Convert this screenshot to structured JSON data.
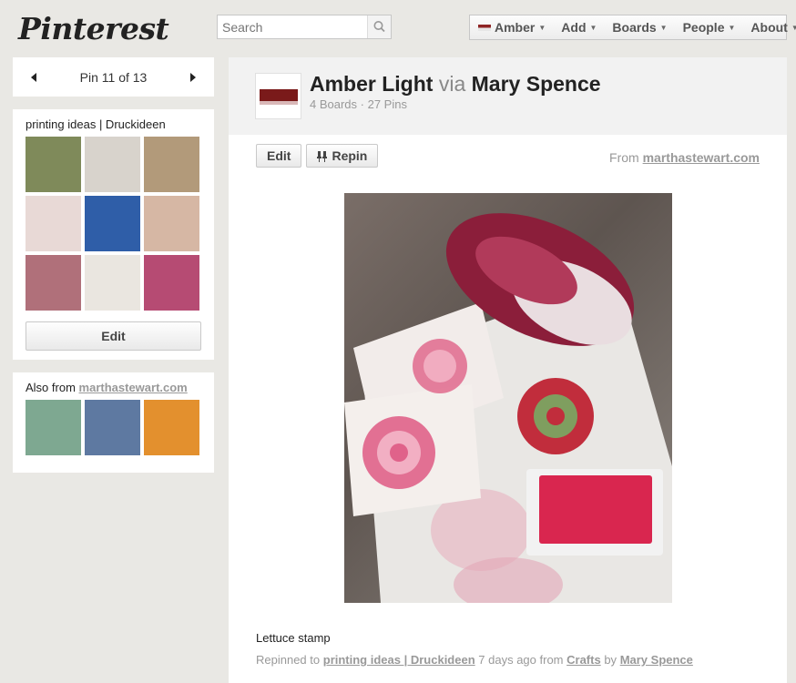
{
  "header": {
    "logo": "Pinterest",
    "search": {
      "placeholder": "Search",
      "value": ""
    },
    "nav": [
      {
        "label": "Amber",
        "flag": true
      },
      {
        "label": "Add"
      },
      {
        "label": "Boards"
      },
      {
        "label": "People"
      },
      {
        "label": "About"
      }
    ]
  },
  "sidebar": {
    "pager": {
      "text": "Pin 11 of 13"
    },
    "board": {
      "title": "printing ideas | Druckideen",
      "edit_label": "Edit",
      "thumbs": [
        "#7f8a5a",
        "#d8d3cc",
        "#b29a7a",
        "#e8d9d6",
        "#2f5ea8",
        "#d6b7a4",
        "#b0707a",
        "#eae6e0",
        "#b64b73"
      ]
    },
    "also": {
      "label": "Also from",
      "link": "marthastewart.com",
      "thumbs": [
        "#7ea891",
        "#5e79a1",
        "#e3902e"
      ]
    }
  },
  "pin": {
    "user_name": "Amber Light",
    "via": "via",
    "via_name": "Mary Spence",
    "stats": "4 Boards · 27 Pins",
    "edit_label": "Edit",
    "repin_label": "Repin",
    "from_label": "From",
    "from_link": "marthastewart.com",
    "description": "Lettuce stamp",
    "credit": {
      "repinned_to": "Repinned to",
      "board": "printing ideas | Druckideen",
      "time": "7 days ago from",
      "source": "Crafts",
      "by": "by",
      "user": "Mary Spence"
    }
  }
}
